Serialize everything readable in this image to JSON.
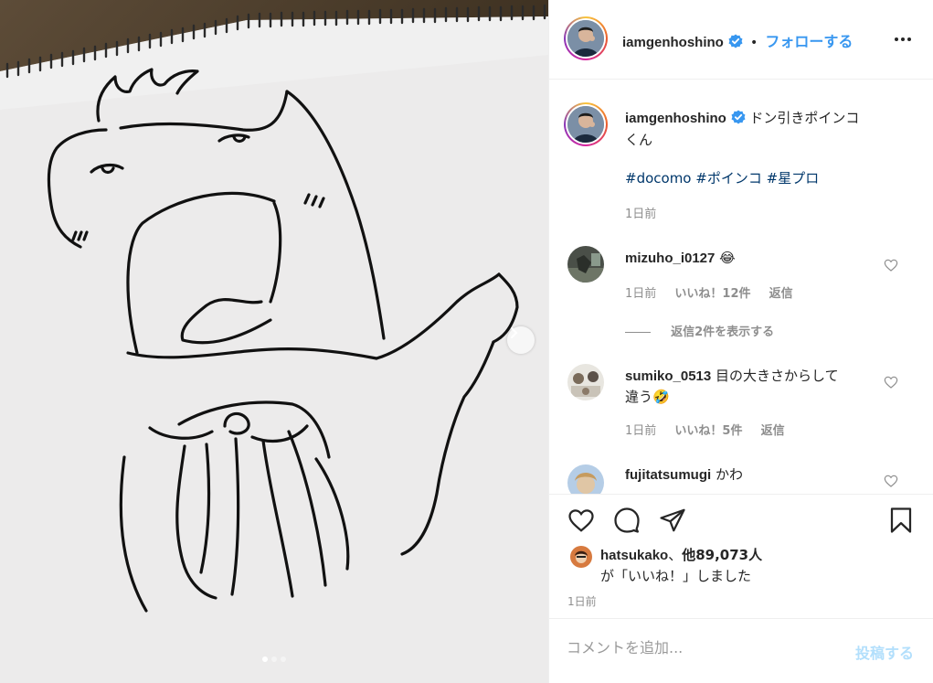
{
  "post": {
    "username": "iamgenhoshino",
    "separator": "•",
    "follow_label": "フォローする",
    "more_icon": "ellipsis-icon",
    "caption_line1": "ドン引きポインコ",
    "caption_line2": "くん",
    "hashtags": [
      "#docomo",
      "#ポインコ",
      "#星プロ"
    ],
    "caption_time": "1日前"
  },
  "comments": [
    {
      "username": "mizuho_i0127",
      "text": "😂",
      "time": "1日前",
      "likes": "いいね！12件",
      "reply": "返信",
      "view_replies": "返信2件を表示する"
    },
    {
      "username": "sumiko_0513",
      "text_line1": "目の大きさからして",
      "text_line2": "違う🤣",
      "time": "1日前",
      "likes": "いいね！5件",
      "reply": "返信"
    },
    {
      "username": "fujitatsumugi",
      "text": "かわ"
    }
  ],
  "likes_summary": {
    "liker": "hatsukako",
    "middle": "、",
    "others": "他89,073人",
    "suffix": "が「いいね！」しました"
  },
  "post_time": "1日前",
  "add_comment": {
    "placeholder": "コメントを追加...",
    "post_label": "投稿する"
  },
  "carousel": {
    "count": 3,
    "active": 0
  },
  "colors": {
    "link": "#3897f0",
    "hashtag": "#00376b",
    "post_disabled": "#b2dffc",
    "verified": "#3897f0"
  }
}
